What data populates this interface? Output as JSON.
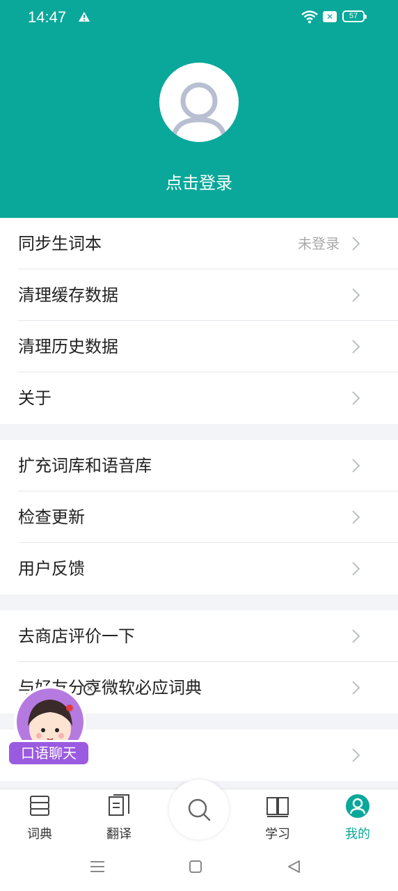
{
  "status_bar": {
    "time": "14:47",
    "battery": "57",
    "icons": [
      "warning-icon",
      "wifi-icon",
      "sim-off-icon",
      "battery-icon"
    ]
  },
  "profile": {
    "login_label": "点击登录",
    "avatar_icon": "user-avatar-icon"
  },
  "settings_groups": [
    {
      "items": [
        {
          "label": "同步生词本",
          "sub": "未登录"
        },
        {
          "label": "清理缓存数据",
          "sub": ""
        },
        {
          "label": "清理历史数据",
          "sub": ""
        },
        {
          "label": "关于",
          "sub": ""
        }
      ]
    },
    {
      "items": [
        {
          "label": "扩充词库和语音库",
          "sub": ""
        },
        {
          "label": "检查更新",
          "sub": ""
        },
        {
          "label": "用户反馈",
          "sub": ""
        }
      ]
    },
    {
      "items": [
        {
          "label": "去商店评价一下",
          "sub": ""
        },
        {
          "label": "与好友分享微软必应词典",
          "sub": ""
        }
      ]
    },
    {
      "items": [
        {
          "label": "",
          "sub": ""
        }
      ]
    }
  ],
  "floating_badge": {
    "label": "口语聊天"
  },
  "tabs": [
    {
      "label": "词典",
      "icon": "dictionary-icon"
    },
    {
      "label": "翻译",
      "icon": "translate-icon"
    },
    {
      "label": "学习",
      "icon": "book-icon"
    },
    {
      "label": "我的",
      "icon": "profile-icon",
      "active": true
    }
  ],
  "colors": {
    "brand": "#0aa89a",
    "badge": "#9b5be0"
  }
}
